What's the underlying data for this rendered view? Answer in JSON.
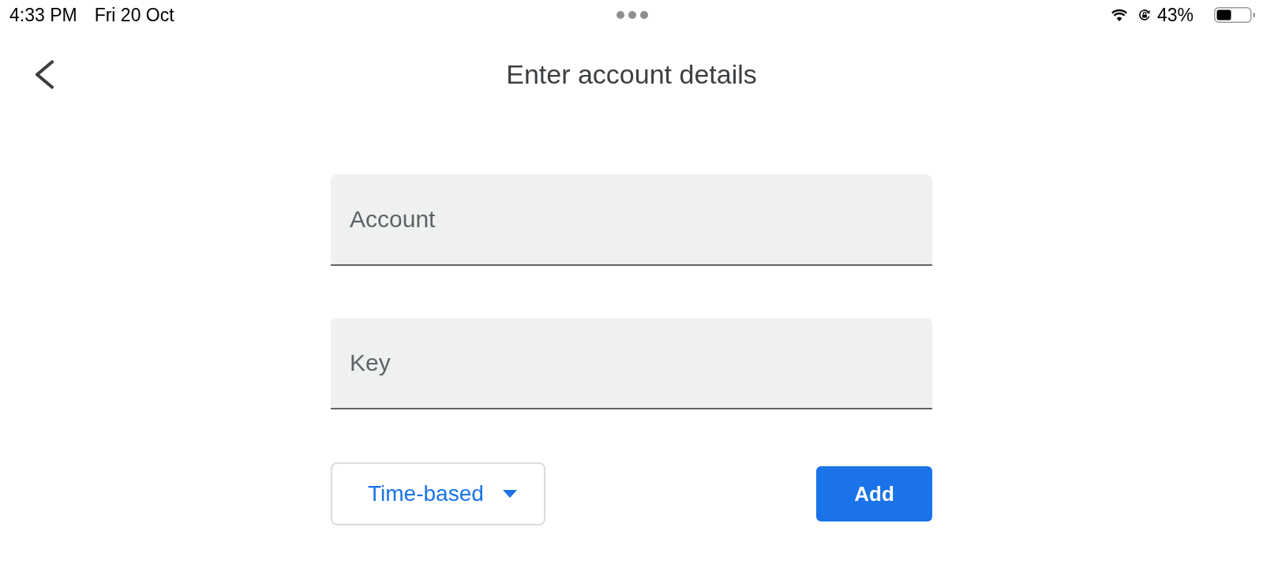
{
  "status_bar": {
    "time": "4:33 PM",
    "date": "Fri 20 Oct",
    "battery_percent": "43%"
  },
  "header": {
    "title": "Enter account details"
  },
  "fields": [
    {
      "placeholder": "Account"
    },
    {
      "placeholder": "Key"
    }
  ],
  "key_type_dropdown": {
    "value": "Time-based"
  },
  "add_button": {
    "label": "Add"
  }
}
